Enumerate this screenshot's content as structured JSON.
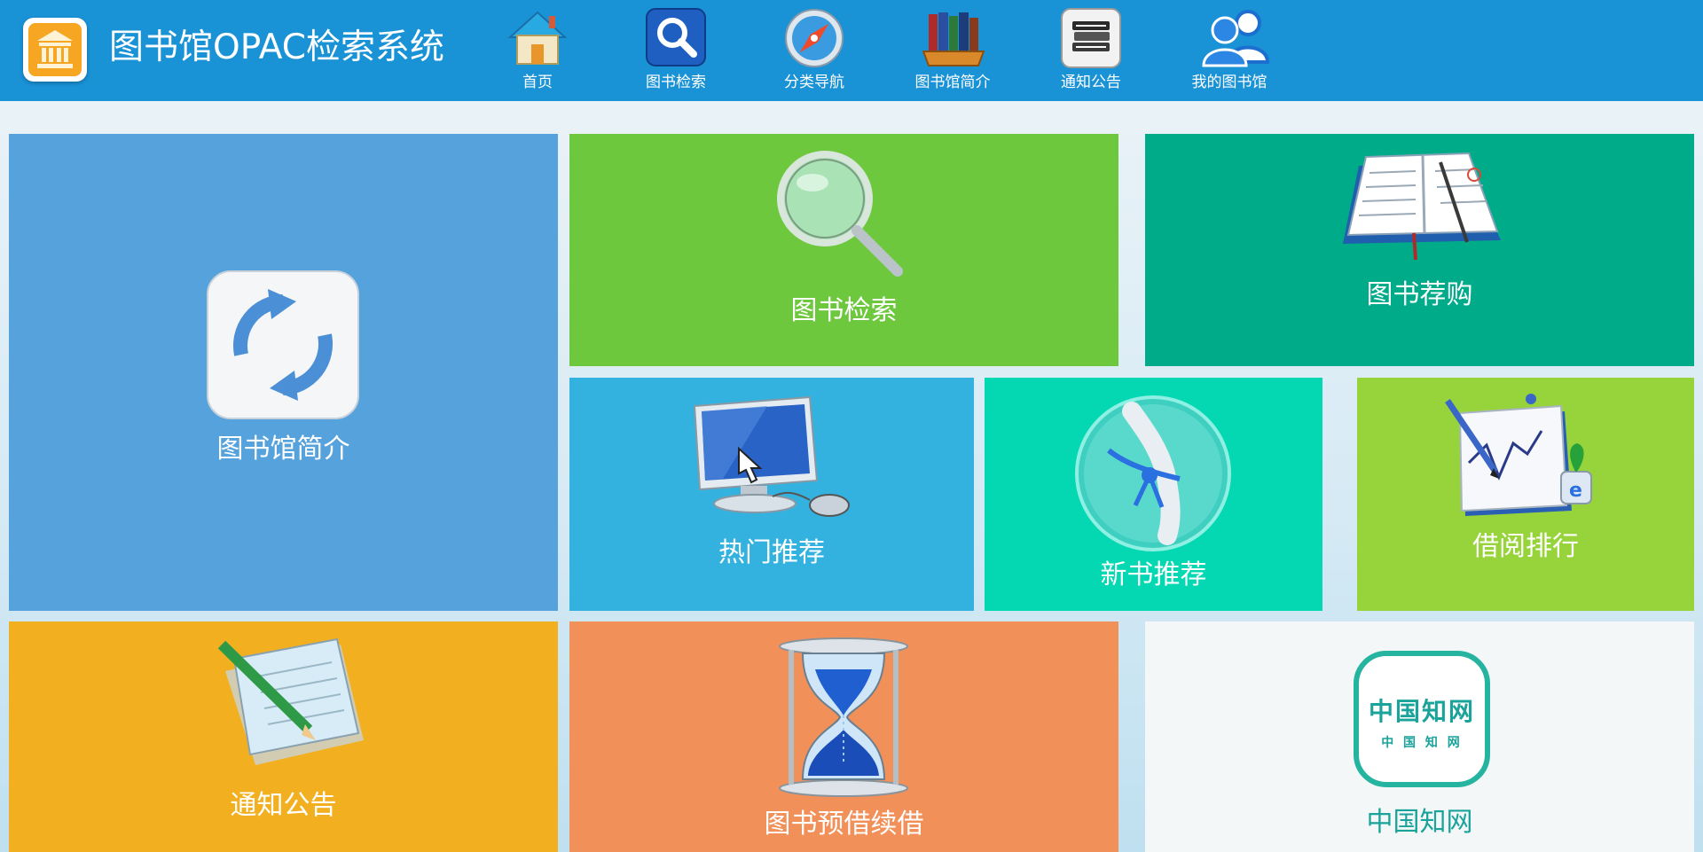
{
  "header": {
    "title": "图书馆OPAC检索系统",
    "logo_icon": "library-building-icon",
    "background": "#1a92d6"
  },
  "nav": {
    "items": [
      {
        "label": "首页",
        "icon": "house-icon"
      },
      {
        "label": "图书检索",
        "icon": "magnifier-icon"
      },
      {
        "label": "分类导航",
        "icon": "compass-icon"
      },
      {
        "label": "图书馆简介",
        "icon": "books-shelf-icon"
      },
      {
        "label": "通知公告",
        "icon": "book-stack-icon"
      },
      {
        "label": "我的图书馆",
        "icon": "users-icon"
      }
    ]
  },
  "tiles": {
    "intro": {
      "label": "图书馆简介",
      "color": "#55a2dc",
      "icon": "refresh-icon"
    },
    "search": {
      "label": "图书检索",
      "color": "#6dc83e",
      "icon": "magnifier-icon"
    },
    "purchase": {
      "label": "图书荐购",
      "color": "#00ab8a",
      "icon": "notebook-icon"
    },
    "hot": {
      "label": "热门推荐",
      "color": "#33b2e0",
      "icon": "computer-click-icon"
    },
    "newbooks": {
      "label": "新书推荐",
      "color": "#03d8b3",
      "icon": "diploma-icon"
    },
    "ranking": {
      "label": "借阅排行",
      "color": "#97d43b",
      "icon": "chart-calendar-icon"
    },
    "notice": {
      "label": "通知公告",
      "color": "#f2b020",
      "icon": "notepad-pencil-icon"
    },
    "renew": {
      "label": "图书预借续借",
      "color": "#f2905a",
      "icon": "hourglass-icon"
    },
    "cnki": {
      "label": "中国知网",
      "color": "#f3f7f7",
      "icon": "cnki-logo-icon",
      "logo_text": "中国知网",
      "logo_subtext": "中 国 知 网",
      "text_color": "#1aa39a"
    }
  }
}
